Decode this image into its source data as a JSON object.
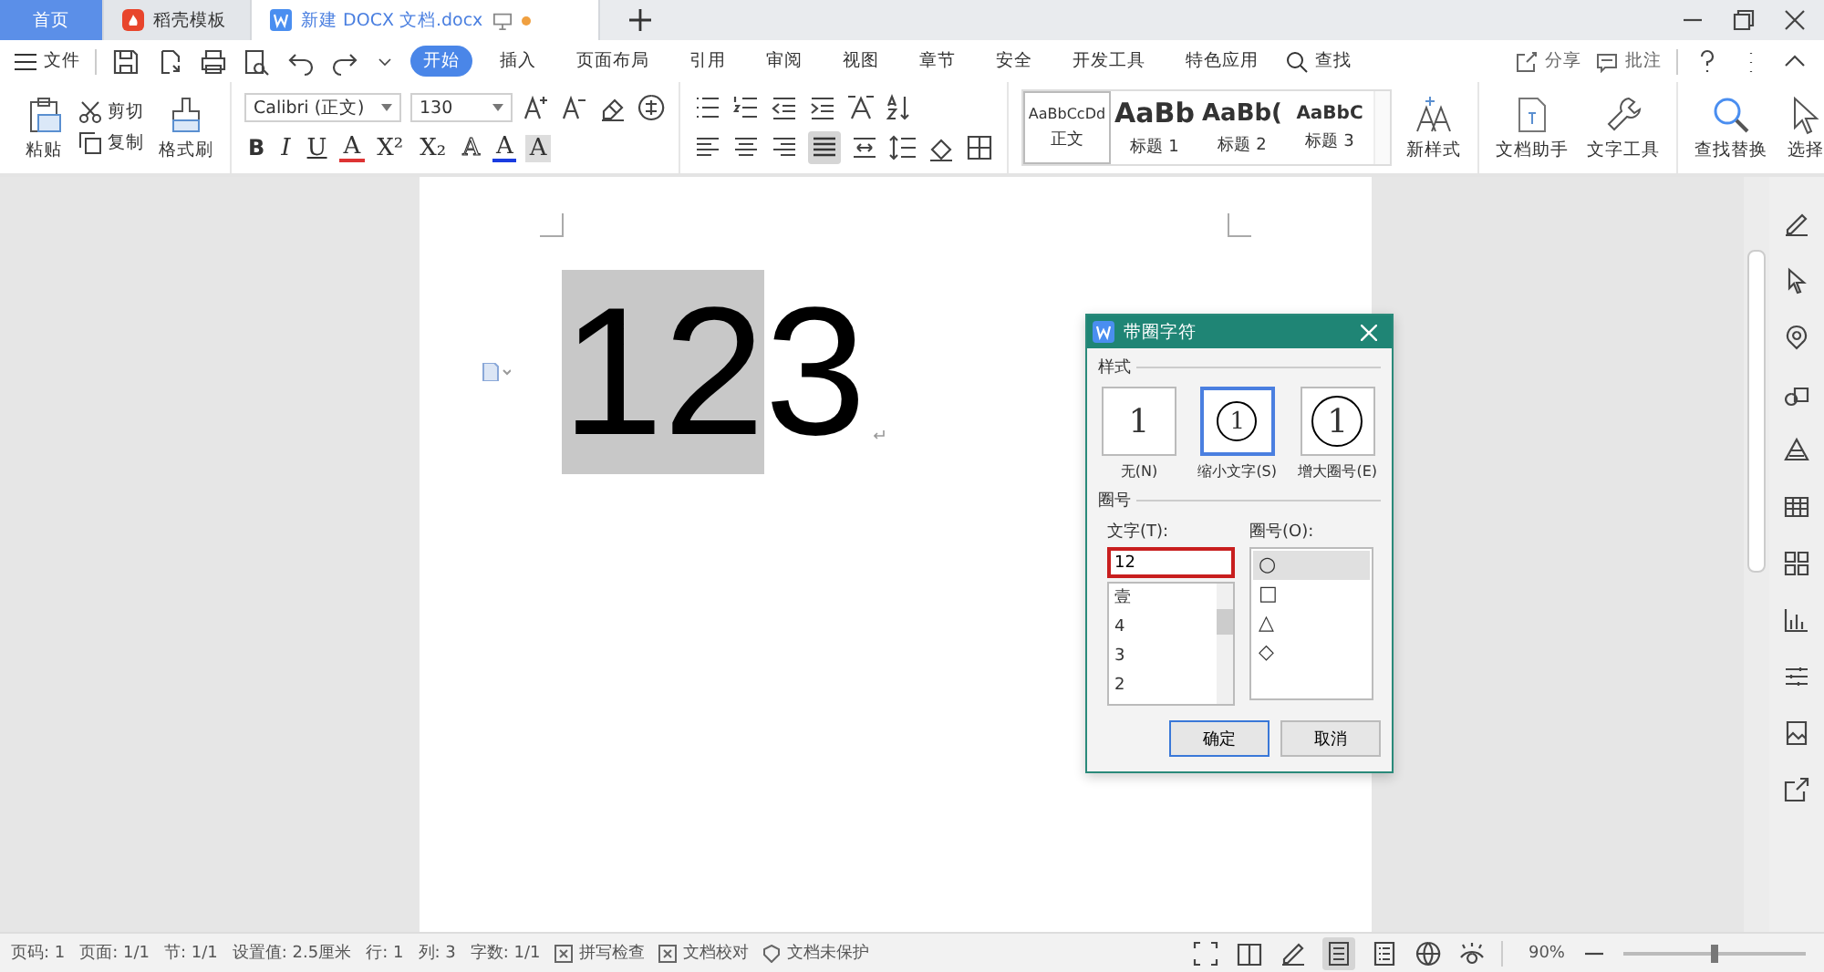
{
  "tabs": [
    {
      "label": "首页",
      "selected": false,
      "kind": "home"
    },
    {
      "label": "稻壳模板",
      "selected": false,
      "kind": "docer"
    },
    {
      "label": "新建 DOCX 文档.docx",
      "selected": true,
      "kind": "doc"
    }
  ],
  "menu": {
    "file": "文件",
    "ribbon_tabs": [
      {
        "label": "开始",
        "selected": true
      },
      {
        "label": "插入",
        "selected": false
      },
      {
        "label": "页面布局",
        "selected": false
      },
      {
        "label": "引用",
        "selected": false
      },
      {
        "label": "审阅",
        "selected": false
      },
      {
        "label": "视图",
        "selected": false
      },
      {
        "label": "章节",
        "selected": false
      },
      {
        "label": "安全",
        "selected": false
      },
      {
        "label": "开发工具",
        "selected": false
      },
      {
        "label": "特色应用",
        "selected": false
      }
    ],
    "search": "查找",
    "share": "分享",
    "comment": "批注"
  },
  "ribbon": {
    "paste": "粘贴",
    "cut": "剪切",
    "copy": "复制",
    "format_painter": "格式刷",
    "font_name": "Calibri (正文)",
    "font_size": "130",
    "format_buttons": [
      {
        "label": "B",
        "kind": "bold"
      },
      {
        "label": "I",
        "kind": "italic"
      },
      {
        "label": "U",
        "kind": "underline"
      },
      {
        "label": "A",
        "kind": "strike"
      },
      {
        "label": "X²",
        "kind": "plain"
      },
      {
        "label": "X₂",
        "kind": "plain"
      },
      {
        "label": "A",
        "kind": "outline"
      },
      {
        "label": "A",
        "kind": "color"
      },
      {
        "label": "A",
        "kind": "shade"
      }
    ],
    "styles": [
      {
        "preview": "AaBbCcDd",
        "label": "正文",
        "kind": "body",
        "selected": true
      },
      {
        "preview": "AaBb",
        "label": "标题 1",
        "kind": "h1",
        "selected": false
      },
      {
        "preview": "AaBb(",
        "label": "标题 2",
        "kind": "h2",
        "selected": false
      },
      {
        "preview": "AaBbC",
        "label": "标题 3",
        "kind": "h3",
        "selected": false
      }
    ],
    "new_style": "新样式",
    "doc_assistant": "文档助手",
    "text_tools": "文字工具",
    "find_replace": "查找替换",
    "select": "选择"
  },
  "document": {
    "selected_text": "12",
    "text": "3"
  },
  "dialog": {
    "title": "带圈字符",
    "style_group": "样式",
    "styles": [
      {
        "label": "无(N)",
        "kind": "none",
        "glyph": "1",
        "selected": false
      },
      {
        "label": "缩小文字(S)",
        "kind": "shrink",
        "glyph": "1",
        "selected": true
      },
      {
        "label": "增大圈号(E)",
        "kind": "enlarge",
        "glyph": "1",
        "selected": false
      }
    ],
    "enclosure_group": "圈号",
    "text_label": "文字(T):",
    "text_value": "12",
    "text_options": [
      "壹",
      "4",
      "3",
      "2"
    ],
    "shape_label": "圈号(O):",
    "shapes": [
      {
        "glyph": "○",
        "selected": true
      },
      {
        "glyph": "□",
        "selected": false
      },
      {
        "glyph": "△",
        "selected": false
      },
      {
        "glyph": "◇",
        "selected": false
      }
    ],
    "buttons": [
      {
        "label": "确定",
        "primary": true
      },
      {
        "label": "取消",
        "primary": false
      }
    ]
  },
  "status_bar": {
    "items": [
      "页码: 1",
      "页面: 1/1",
      "节: 1/1",
      "设置值: 2.5厘米",
      "行: 1",
      "列: 3",
      "字数: 1/1"
    ],
    "toggles": [
      "拼写检查",
      "文档校对",
      "文档未保护"
    ],
    "zoom": "90%",
    "zoom_slider": {
      "level": 0.5
    }
  }
}
